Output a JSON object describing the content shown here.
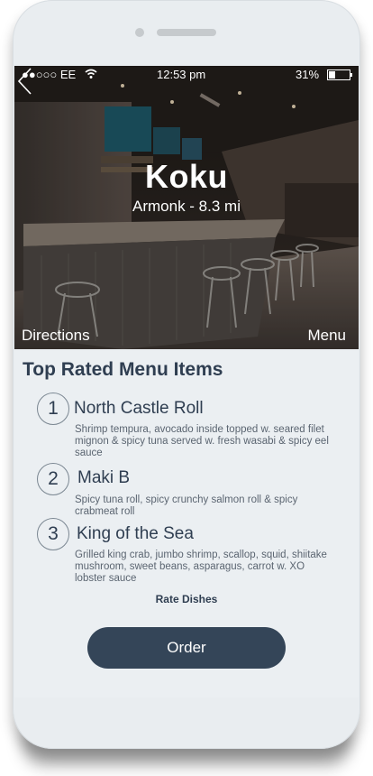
{
  "status_bar": {
    "carrier": "●●○○○ EE",
    "time": "12:53 pm",
    "battery": "31%",
    "battery_level": 0.31
  },
  "restaurant": {
    "name": "Koku",
    "location": "Armonk - 8.3 mi"
  },
  "hero_actions": {
    "directions": "Directions",
    "menu": "Menu"
  },
  "section_title": "Top Rated Menu Items",
  "items": [
    {
      "rank": "1",
      "name": "North Castle Roll",
      "description": "Shrimp tempura, avocado inside topped w. seared filet mignon & spicy tuna served w. fresh wasabi & spicy eel sauce"
    },
    {
      "rank": "2",
      "name": "Maki B",
      "description": "Spicy tuna roll, spicy crunchy salmon roll & spicy crabmeat roll"
    },
    {
      "rank": "3",
      "name": "King of the Sea",
      "description": "Grilled king crab, jumbo shrimp, scallop, squid, shiitake mushroom, sweet beans, asparagus, carrot w. XO lobster sauce"
    }
  ],
  "rate_label": "Rate Dishes",
  "order_label": "Order",
  "colors": {
    "accent": "#344558",
    "heading": "#2f3e51",
    "background": "#ebeff2"
  }
}
